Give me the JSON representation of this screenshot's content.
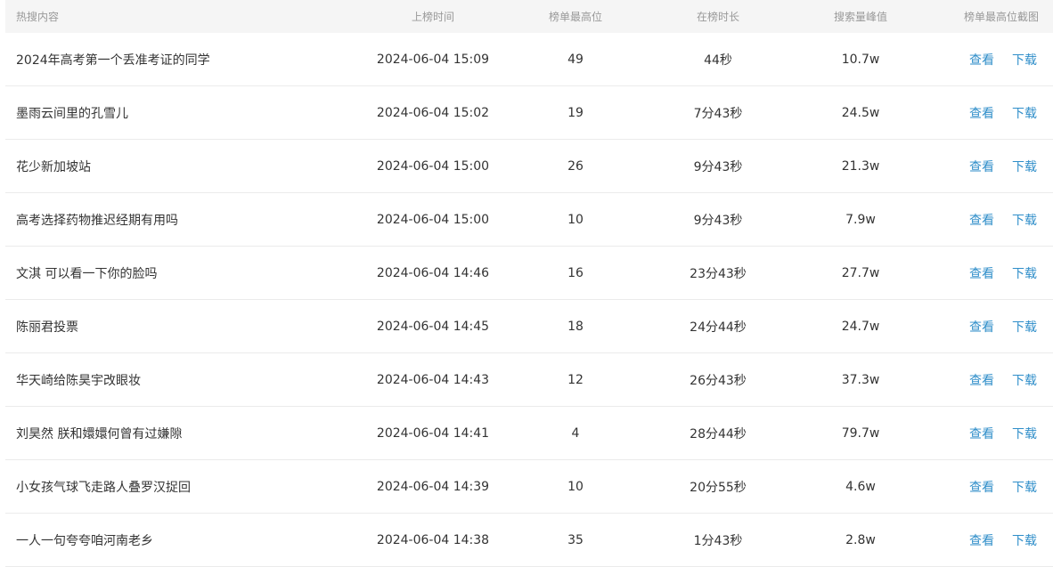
{
  "header": {
    "title": "热搜内容",
    "time": "上榜时间",
    "rank": "榜单最高位",
    "duration": "在榜时长",
    "peak": "搜索量峰值",
    "screenshot": "榜单最高位截图"
  },
  "actions": {
    "view": "查看",
    "download": "下载"
  },
  "rows": [
    {
      "title": "2024年高考第一个丢准考证的同学",
      "time": "2024-06-04 15:09",
      "rank": "49",
      "duration": "44秒",
      "peak": "10.7w"
    },
    {
      "title": "墨雨云间里的孔雪儿",
      "time": "2024-06-04 15:02",
      "rank": "19",
      "duration": "7分43秒",
      "peak": "24.5w"
    },
    {
      "title": "花少新加坡站",
      "time": "2024-06-04 15:00",
      "rank": "26",
      "duration": "9分43秒",
      "peak": "21.3w"
    },
    {
      "title": "高考选择药物推迟经期有用吗",
      "time": "2024-06-04 15:00",
      "rank": "10",
      "duration": "9分43秒",
      "peak": "7.9w"
    },
    {
      "title": "文淇 可以看一下你的脸吗",
      "time": "2024-06-04 14:46",
      "rank": "16",
      "duration": "23分43秒",
      "peak": "27.7w"
    },
    {
      "title": "陈丽君投票",
      "time": "2024-06-04 14:45",
      "rank": "18",
      "duration": "24分44秒",
      "peak": "24.7w"
    },
    {
      "title": "华天崎给陈昊宇改眼妆",
      "time": "2024-06-04 14:43",
      "rank": "12",
      "duration": "26分43秒",
      "peak": "37.3w"
    },
    {
      "title": "刘昊然 朕和嬛嬛何曾有过嫌隙",
      "time": "2024-06-04 14:41",
      "rank": "4",
      "duration": "28分44秒",
      "peak": "79.7w"
    },
    {
      "title": "小女孩气球飞走路人叠罗汉捉回",
      "time": "2024-06-04 14:39",
      "rank": "10",
      "duration": "20分55秒",
      "peak": "4.6w"
    },
    {
      "title": "一人一句夸夸咱河南老乡",
      "time": "2024-06-04 14:38",
      "rank": "35",
      "duration": "1分43秒",
      "peak": "2.8w"
    }
  ]
}
